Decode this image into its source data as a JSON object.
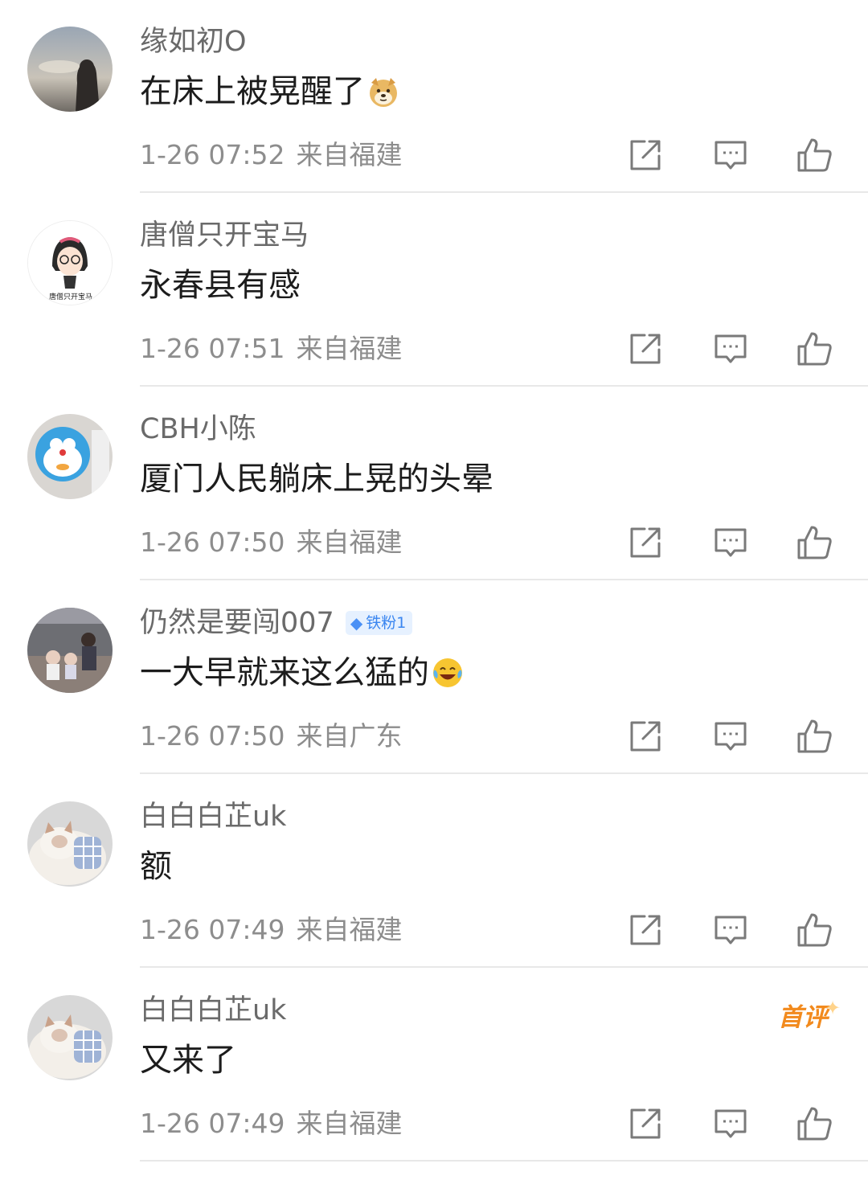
{
  "comments": [
    {
      "name": "缘如初O",
      "text": "在床上被晃醒了",
      "emoji": "doge-emoji",
      "time": "1-26 07:52",
      "location": "来自福建"
    },
    {
      "name": "唐僧只开宝马",
      "text": "永春县有感",
      "avatar_caption": "唐僧只开宝马",
      "time": "1-26 07:51",
      "location": "来自福建"
    },
    {
      "name": "CBH小陈",
      "text": "厦门人民躺床上晃的头晕",
      "time": "1-26 07:50",
      "location": "来自福建"
    },
    {
      "name": "仍然是要闯007",
      "badge": "铁粉1",
      "text": "一大早就来这么猛的",
      "emoji": "laugh-cry-emoji",
      "time": "1-26 07:50",
      "location": "来自广东"
    },
    {
      "name": "白白白芷uk",
      "text": "额",
      "time": "1-26 07:49",
      "location": "来自福建"
    },
    {
      "name": "白白白芷uk",
      "text": "又来了",
      "tag": "首评",
      "time": "1-26 07:49",
      "location": "来自福建"
    }
  ],
  "icons": {
    "share": "share-icon",
    "reply": "comment-icon",
    "like": "like-icon"
  },
  "colors": {
    "name": "#6a6a6a",
    "text": "#1c1c1c",
    "meta": "#8d8d8d",
    "icon": "#7a7a7a",
    "badge_text": "#3a86f0",
    "badge_bg": "#e6f1ff",
    "first_tag": "#f28a1d",
    "divider": "#e8e8e8"
  }
}
